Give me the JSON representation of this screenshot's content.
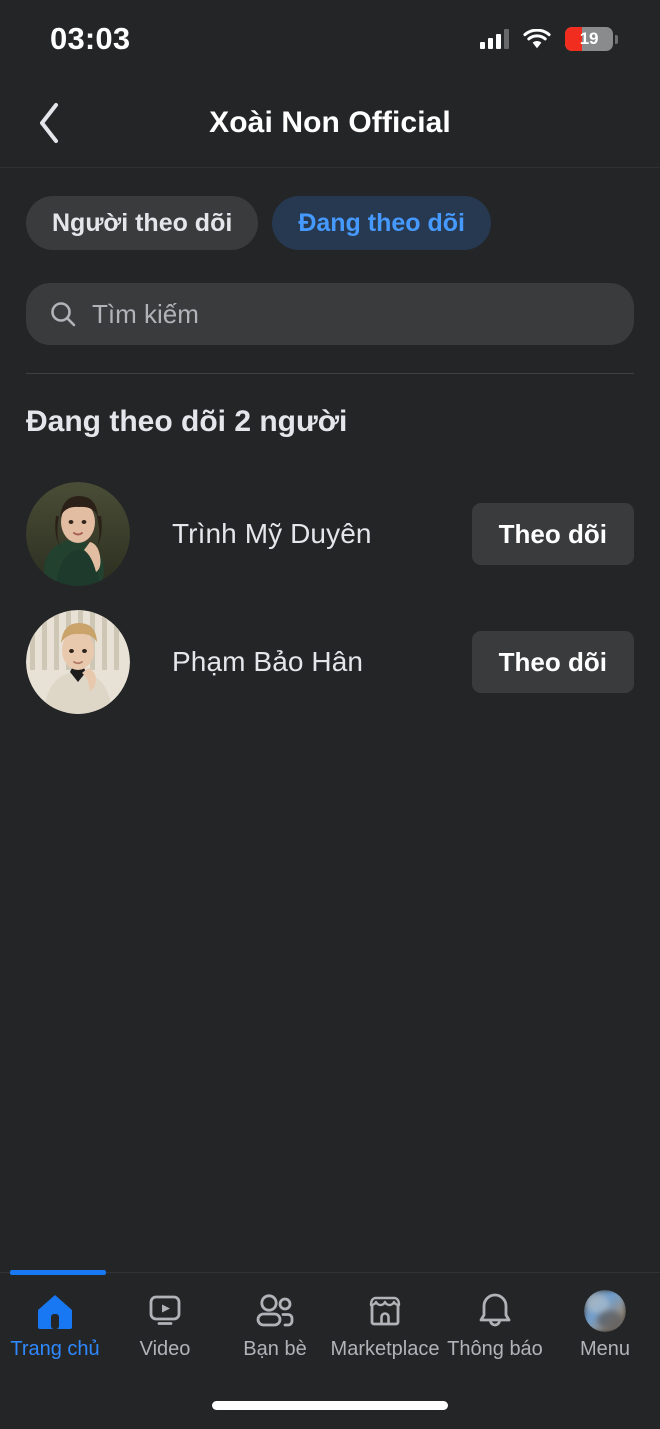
{
  "statusbar": {
    "time": "03:03",
    "signal_icon": "cellular-signal-icon",
    "signal_bars_filled": 3,
    "signal_bars_total": 4,
    "wifi_icon": "wifi-icon",
    "battery_icon": "battery-icon",
    "battery_level": "19",
    "battery_color": "#f02d1f"
  },
  "header": {
    "back_icon": "chevron-left-icon",
    "title": "Xoài Non Official"
  },
  "tabs": [
    {
      "label": "Người theo dõi",
      "active": false
    },
    {
      "label": "Đang theo dõi",
      "active": true
    }
  ],
  "search": {
    "icon": "search-icon",
    "placeholder": "Tìm kiếm",
    "value": ""
  },
  "section": {
    "title": "Đang theo dõi 2 người"
  },
  "people": [
    {
      "name": "Trình Mỹ Duyên",
      "avatar": "avatar-trinh-my-duyen",
      "action_label": "Theo dõi"
    },
    {
      "name": "Phạm Bảo Hân",
      "avatar": "avatar-pham-bao-han",
      "action_label": "Theo dõi"
    }
  ],
  "bottom_nav": {
    "items": [
      {
        "label": "Trang chủ",
        "icon": "home-icon",
        "active": true
      },
      {
        "label": "Video",
        "icon": "video-icon",
        "active": false
      },
      {
        "label": "Bạn bè",
        "icon": "friends-icon",
        "active": false
      },
      {
        "label": "Marketplace",
        "icon": "marketplace-icon",
        "active": false
      },
      {
        "label": "Thông báo",
        "icon": "bell-icon",
        "active": false
      },
      {
        "label": "Menu",
        "icon": "profile-avatar-icon",
        "active": false
      }
    ],
    "active_color": "#1877f2",
    "inactive_color": "#b0b3b8"
  }
}
